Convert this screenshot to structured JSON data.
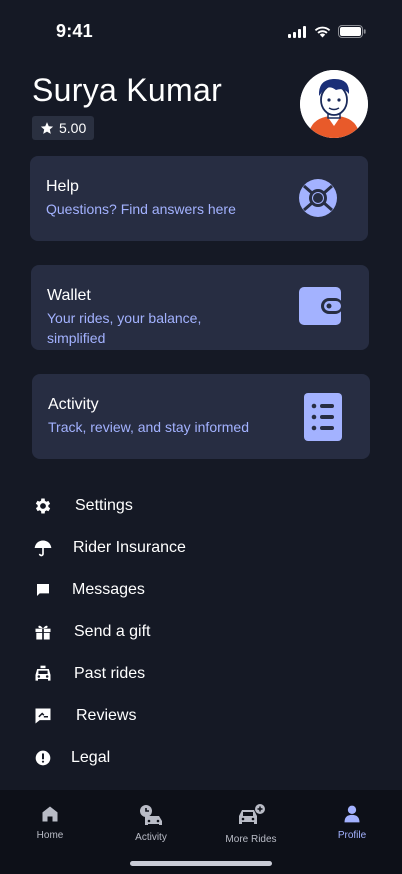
{
  "status_bar": {
    "time": "9:41"
  },
  "profile": {
    "name": "Surya Kumar",
    "rating": "5.00"
  },
  "cards": [
    {
      "title": "Help",
      "subtitle": "Questions? Find answers here",
      "icon": "lifebuoy-icon"
    },
    {
      "title": "Wallet",
      "subtitle": "Your rides, your balance, simplified",
      "icon": "wallet-icon"
    },
    {
      "title": "Activity",
      "subtitle": "Track, review, and stay informed",
      "icon": "list-document-icon"
    }
  ],
  "menu": [
    {
      "label": "Settings",
      "icon": "gear-icon"
    },
    {
      "label": "Rider Insurance",
      "icon": "umbrella-icon"
    },
    {
      "label": "Messages",
      "icon": "chat-icon"
    },
    {
      "label": "Send a gift",
      "icon": "gift-icon"
    },
    {
      "label": "Past rides",
      "icon": "taxi-icon"
    },
    {
      "label": "Reviews",
      "icon": "review-icon"
    },
    {
      "label": "Legal",
      "icon": "info-icon"
    }
  ],
  "bottom_nav": [
    {
      "label": "Home",
      "icon": "home-icon",
      "active": false
    },
    {
      "label": "Activity",
      "icon": "activity-icon",
      "active": false
    },
    {
      "label": "More Rides",
      "icon": "more-rides-icon",
      "active": false
    },
    {
      "label": "Profile",
      "icon": "profile-icon",
      "active": true
    }
  ],
  "colors": {
    "background": "#151925",
    "card": "#272d42",
    "accent": "#a3b2ff",
    "nav_background": "#0d1018"
  }
}
